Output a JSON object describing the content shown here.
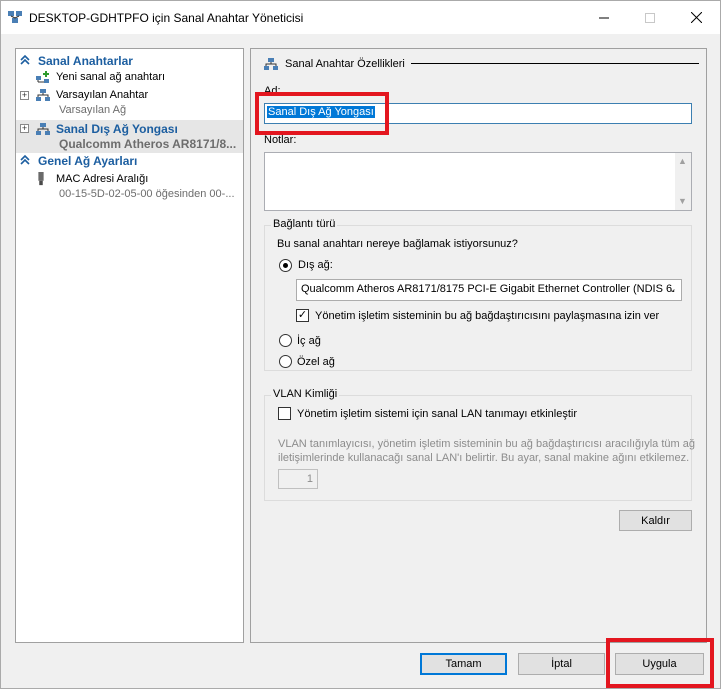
{
  "window": {
    "title": "DESKTOP-GDHTPFO için Sanal Anahtar Yöneticisi"
  },
  "tree": {
    "section_switches": "Sanal Anahtarlar",
    "new_switch": "Yeni sanal ağ anahtarı",
    "default_switch": {
      "name": "Varsayılan Anahtar",
      "sub": "Varsayılan Ağ"
    },
    "external_switch": {
      "name": "Sanal Dış Ağ Yongası",
      "sub": "Qualcomm Atheros AR8171/8..."
    },
    "section_global": "Genel Ağ Ayarları",
    "mac_range": {
      "name": "MAC Adresi Aralığı",
      "sub": "00-15-5D-02-05-00 öğesinden 00-..."
    }
  },
  "props": {
    "header": "Sanal Anahtar Özellikleri",
    "name_label": "Ad:",
    "name_value": "Sanal Dış Ağ Yongası",
    "notes_label": "Notlar:",
    "conn_group_title": "Bağlantı türü",
    "conn_question": "Bu sanal anahtarı nereye bağlamak istiyorsunuz?",
    "external_label": "Dış ağ:",
    "adapter_selected": "Qualcomm Atheros AR8171/8175 PCI-E Gigabit Ethernet Controller (NDIS 6.",
    "allow_share_label": "Yönetim işletim sisteminin bu ağ bağdaştırıcısını paylaşmasına izin ver",
    "internal_label": "İç ağ",
    "private_label": "Özel ağ",
    "vlan_group_title": "VLAN Kimliği",
    "vlan_enable_label": "Yönetim işletim sistemi için sanal LAN tanımayı etkinleştir",
    "vlan_desc_line1": "VLAN tanımlayıcısı, yönetim işletim sisteminin bu ağ bağdaştırıcısı aracılığıyla tüm ağ",
    "vlan_desc_line2": "iletişimlerinde kullanacağı sanal LAN'ı belirtir. Bu ayar, sanal makine ağını etkilemez.",
    "vlan_value": "1",
    "remove_button": "Kaldır"
  },
  "footer": {
    "ok": "Tamam",
    "cancel": "İptal",
    "apply": "Uygula"
  },
  "state": {
    "connection_type": "external",
    "allow_share_checked": true,
    "vlan_enabled": false
  },
  "colors": {
    "accent": "#0078d7",
    "tree_header": "#1c5ea0",
    "highlight_box": "#e3161f"
  }
}
